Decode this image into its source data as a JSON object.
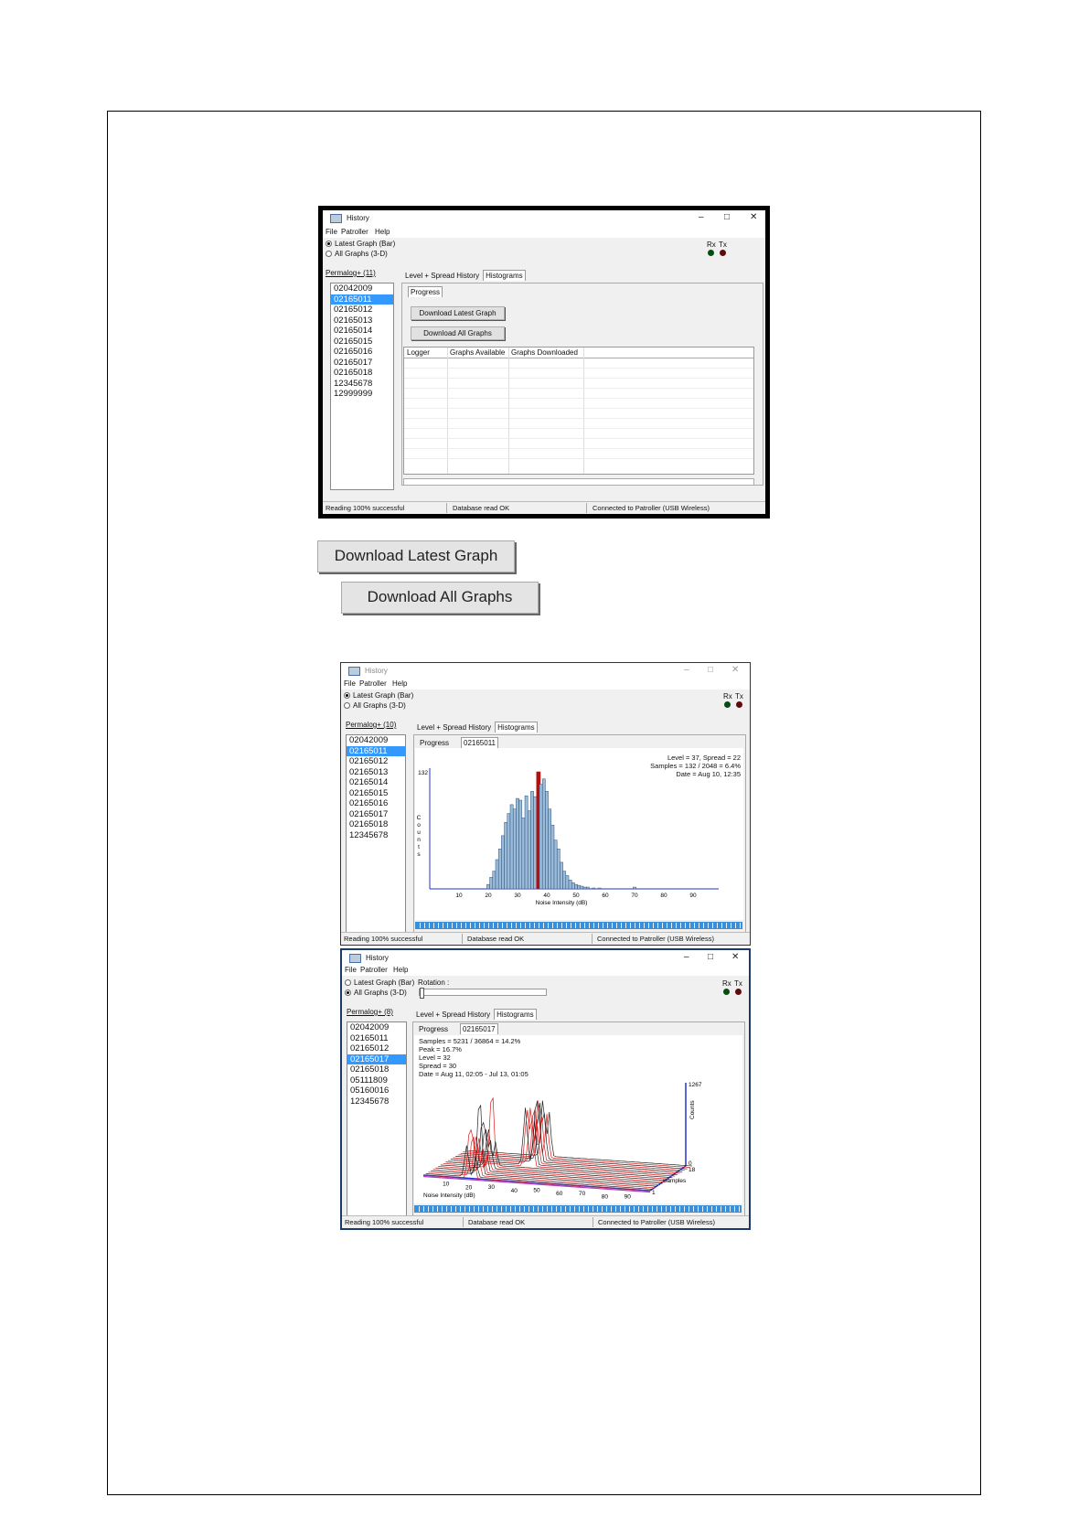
{
  "window": {
    "title": "History",
    "menu": [
      "File",
      "Patroller",
      "Help"
    ],
    "rx_label": "Rx",
    "tx_label": "Tx",
    "radio_bar": "Latest Graph (Bar)",
    "radio_3d": "All Graphs (3-D)",
    "tab_level_spread": "Level + Spread History",
    "tab_histograms": "Histograms",
    "subtab_progress": "Progress",
    "status_reading": "Reading 100% successful",
    "status_database": "Database read OK",
    "status_connection": "Connected to Patroller (USB Wireless)",
    "colors": {
      "selection": "#3399ff",
      "rx_led": "#064d12",
      "tx_led": "#600b0b",
      "bar_fill": "#9bbcd9",
      "highlight_bar": "#b01010",
      "axis": "#2233cc"
    }
  },
  "screen1": {
    "loggers_label": "Permalog+ (11)",
    "loggers": [
      "02042009",
      "02165011",
      "02165012",
      "02165013",
      "02165014",
      "02165015",
      "02165016",
      "02165017",
      "02165018",
      "12345678",
      "12999999"
    ],
    "selected_index": 1,
    "download_latest_btn": "Download Latest Graph",
    "download_all_btn": "Download All Graphs",
    "table_headers": [
      "Logger",
      "Graphs Available",
      "Graphs Downloaded"
    ]
  },
  "callouts": {
    "download_latest": "Download Latest Graph",
    "download_all": "Download All Graphs"
  },
  "screen2": {
    "loggers_label": "Permalog+ (10)",
    "loggers": [
      "02042009",
      "02165011",
      "02165012",
      "02165013",
      "02165014",
      "02165015",
      "02165016",
      "02165017",
      "02165018",
      "12345678"
    ],
    "selected_index": 1,
    "subtab_logger": "02165011",
    "info": [
      "Level = 37, Spread = 22",
      "Samples = 132 / 2048 = 6.4%",
      "Date = Aug 10, 12:35"
    ],
    "chart_data": {
      "type": "bar",
      "xlabel": "Noise Intensity (dB)",
      "ylabel": "Counts",
      "y_tick": "132",
      "x_ticks": [
        "10",
        "20",
        "30",
        "40",
        "50",
        "60",
        "70",
        "80",
        "90"
      ],
      "xlim": [
        0,
        100
      ],
      "ylim": [
        0,
        132
      ],
      "highlight_level": 37,
      "bins": [
        20,
        21,
        22,
        23,
        24,
        25,
        26,
        27,
        28,
        29,
        30,
        31,
        32,
        33,
        34,
        35,
        36,
        37,
        38,
        39,
        40,
        41,
        42,
        43,
        44,
        45,
        46,
        47,
        48,
        49,
        50,
        51,
        52,
        53,
        54,
        56,
        58,
        70
      ],
      "values": [
        5,
        13,
        20,
        33,
        45,
        60,
        75,
        85,
        95,
        90,
        102,
        100,
        80,
        105,
        88,
        110,
        104,
        132,
        118,
        124,
        110,
        90,
        72,
        55,
        45,
        30,
        20,
        15,
        10,
        7,
        5,
        4,
        3,
        2,
        2,
        1,
        1,
        2
      ]
    }
  },
  "screen3": {
    "loggers_label": "Permalog+ (8)",
    "loggers": [
      "02042009",
      "02165011",
      "02165012",
      "02165017",
      "02165018",
      "05111809",
      "05160016",
      "12345678"
    ],
    "selected_index": 3,
    "rotation_label": "Rotation :",
    "subtab_logger": "02165017",
    "info": [
      "Samples = 5231 / 36864 = 14.2%",
      "Peak = 16.7%",
      "Level = 32",
      "Spread = 30",
      "Date = Aug 11, 02:05 - Jul 13, 01:05"
    ],
    "chart_data": {
      "type": "line",
      "xlabel": "Noise Intensity (dB)",
      "ylabel": "Counts",
      "zlabel": "Samples",
      "x_ticks": [
        "10",
        "20",
        "30",
        "40",
        "50",
        "60",
        "70",
        "80",
        "90"
      ],
      "y_ticks": [
        "1267",
        "0"
      ],
      "z_ticks": [
        "18",
        "1"
      ],
      "series_count": 18
    }
  }
}
